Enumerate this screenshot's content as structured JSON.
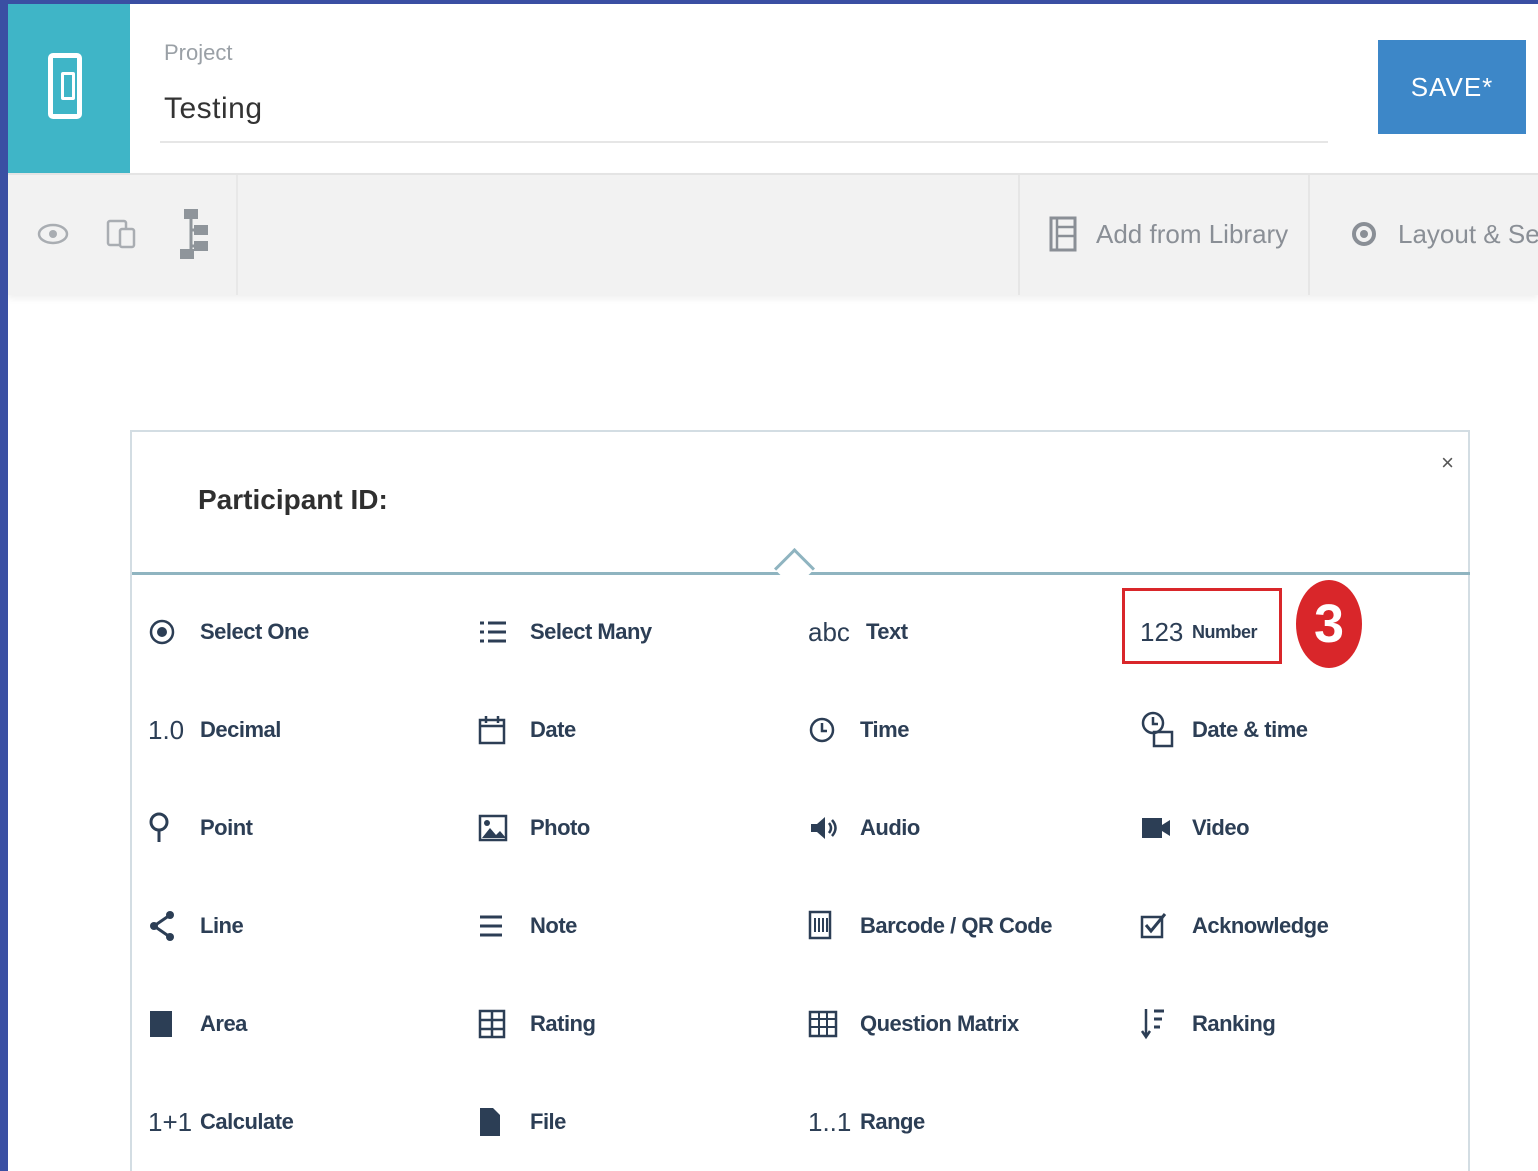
{
  "header": {
    "project_label": "Project",
    "project_value": "Testing",
    "save_label": "SAVE*"
  },
  "toolbar": {
    "add_from_library": "Add from Library",
    "layout_settings": "Layout & Setti"
  },
  "card": {
    "title": "Participant ID:",
    "close": "×"
  },
  "question_types": [
    {
      "icon": "radio-icon",
      "label": "Select One"
    },
    {
      "icon": "list-icon",
      "label": "Select Many"
    },
    {
      "icon": "abc",
      "label": "Text"
    },
    {
      "icon": "123",
      "label": "Number"
    },
    {
      "icon": "1.0",
      "label": "Decimal"
    },
    {
      "icon": "calendar-icon",
      "label": "Date"
    },
    {
      "icon": "clock-icon",
      "label": "Time"
    },
    {
      "icon": "datetime-icon",
      "label": "Date & time"
    },
    {
      "icon": "pin-icon",
      "label": "Point"
    },
    {
      "icon": "photo-icon",
      "label": "Photo"
    },
    {
      "icon": "speaker-icon",
      "label": "Audio"
    },
    {
      "icon": "video-icon",
      "label": "Video"
    },
    {
      "icon": "line-icon",
      "label": "Line"
    },
    {
      "icon": "note-icon",
      "label": "Note"
    },
    {
      "icon": "barcode-icon",
      "label": "Barcode / QR Code"
    },
    {
      "icon": "checkbox-icon",
      "label": "Acknowledge"
    },
    {
      "icon": "area-icon",
      "label": "Area"
    },
    {
      "icon": "rating-icon",
      "label": "Rating"
    },
    {
      "icon": "matrix-icon",
      "label": "Question Matrix"
    },
    {
      "icon": "ranking-icon",
      "label": "Ranking"
    },
    {
      "icon": "1+1",
      "label": "Calculate"
    },
    {
      "icon": "file-icon",
      "label": "File"
    },
    {
      "icon": "1..1",
      "label": "Range"
    }
  ],
  "annotation": {
    "step_number": "3",
    "highlight_color": "#d9262a"
  },
  "colors": {
    "accent": "#3fb5c7",
    "save_button": "#3d87c8",
    "frame_border": "#3a4fa3"
  }
}
